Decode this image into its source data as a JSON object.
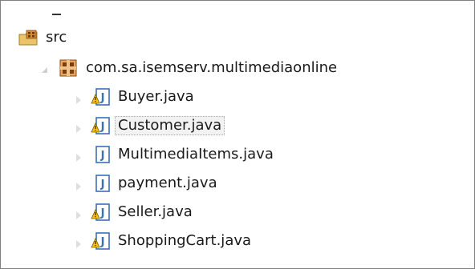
{
  "tree": {
    "source_folder": {
      "label": "src",
      "icon": "source-folder-icon"
    },
    "package": {
      "label": "com.sa.isemserv.multimediaonline",
      "icon": "package-icon",
      "expanded": true
    },
    "files": [
      {
        "label": "Buyer.java",
        "icon": "java-file-icon",
        "warning": true
      },
      {
        "label": "Customer.java",
        "icon": "java-file-icon",
        "warning": true,
        "selected": true
      },
      {
        "label": "MultimediaItems.java",
        "icon": "java-file-icon",
        "warning": false
      },
      {
        "label": "payment.java",
        "icon": "java-file-icon",
        "warning": false
      },
      {
        "label": "Seller.java",
        "icon": "java-file-icon",
        "warning": true
      },
      {
        "label": "ShoppingCart.java",
        "icon": "java-file-icon",
        "warning": true
      }
    ]
  },
  "colors": {
    "java_icon_blue": "#3d6fb4",
    "warning_yellow": "#f5c400",
    "package_brown": "#b5651d",
    "selection_bg": "#f2f2f2"
  }
}
